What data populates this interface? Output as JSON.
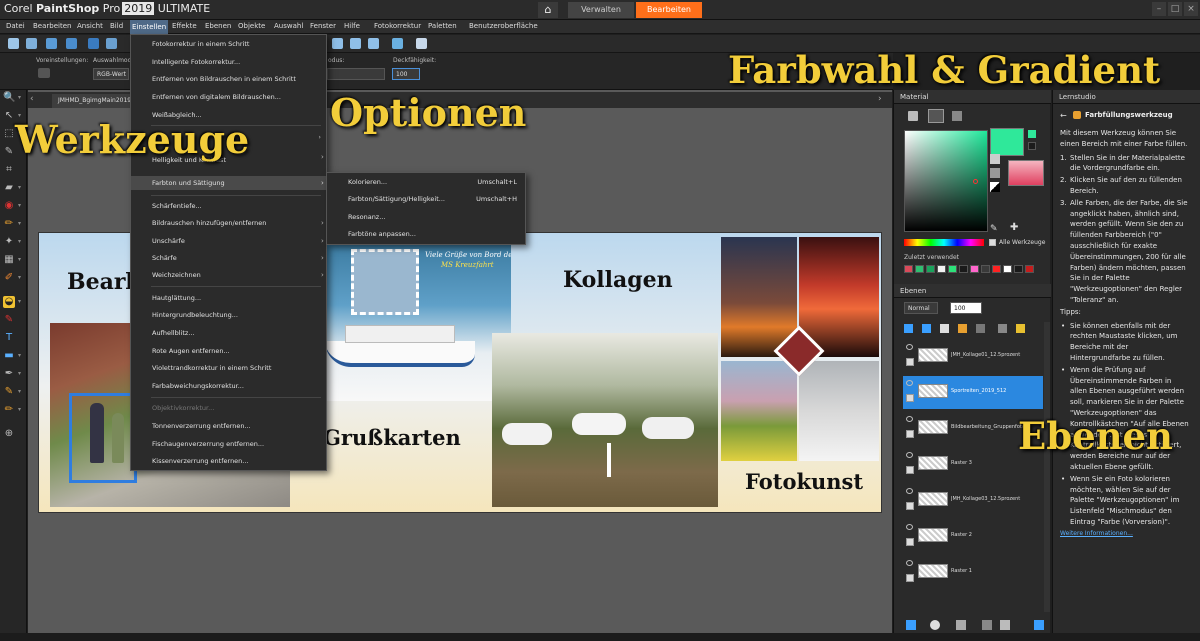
{
  "app": {
    "brand": "Corel",
    "product": "PaintShop",
    "pro": "Pro",
    "year": "2019",
    "edition": "ULTIMATE",
    "workspace_tabs": [
      "Verwalten",
      "Bearbeiten"
    ],
    "active_workspace": "Bearbeiten"
  },
  "menubar": [
    "Datei",
    "Bearbeiten",
    "Ansicht",
    "Bild",
    "Einstellen",
    "Effekte",
    "Ebenen",
    "Objekte",
    "Auswahl",
    "Fenster",
    "Hilfe",
    "Fotokorrektur",
    "Paletten",
    "Benutzeroberfläche"
  ],
  "options": {
    "preset_label": "Voreinstellungen:",
    "select_label": "Auswahlmodus",
    "select_value": "RGB-Wert",
    "mode_label": "odus:",
    "opacity_label": "Deckfähigkeit:",
    "opacity_value": "100"
  },
  "document": {
    "tab": "JMHMD_BgimgMain2019_512.pspimage"
  },
  "menu_einstellen": [
    {
      "label": "Fotokorrektur in einem Schritt"
    },
    {
      "label": "Intelligente Fotokorrektur..."
    },
    {
      "label": "Entfernen von Bildrauschen in einem Schritt"
    },
    {
      "label": "Entfernen von digitalem Bildrauschen..."
    },
    {
      "label": "Weißabgleich..."
    },
    {
      "label": "Helligkeit und Kontrast"
    },
    {
      "label": "Farbton und Sättigung"
    },
    {
      "label": "Schärfentiefe..."
    },
    {
      "label": "Bildrauschen hinzufügen/entfernen"
    },
    {
      "label": "Unschärfe"
    },
    {
      "label": "Schärfe"
    },
    {
      "label": "Weichzeichnen"
    },
    {
      "label": "Hautglättung..."
    },
    {
      "label": "Hintergrundbeleuchtung..."
    },
    {
      "label": "Aufhellblitz..."
    },
    {
      "label": "Rote Augen entfernen..."
    },
    {
      "label": "Violettrandkorrektur in einem Schritt"
    },
    {
      "label": "Farbabweichungskorrektur..."
    },
    {
      "label": "Objektivkorrektur..."
    },
    {
      "label": "Tonnenverzerrung entfernen..."
    },
    {
      "label": "Fischaugenverzerrung entfernen..."
    },
    {
      "label": "Kissenverzerrung entfernen..."
    }
  ],
  "submenu_farbton": [
    {
      "label": "Kolorieren...",
      "shortcut": "Umschalt+L"
    },
    {
      "label": "Farbton/Sättigung/Helligkeit...",
      "shortcut": "Umschalt+H"
    },
    {
      "label": "Resonanz...",
      "shortcut": ""
    },
    {
      "label": "Farbtöne anpassen...",
      "shortcut": ""
    }
  ],
  "canvas": {
    "bearb": "Bearb",
    "kollagen": "Kollagen",
    "grusskarten": "Grußkarten",
    "fotokunst": "Fotokunst",
    "greeting": "Viele Grüße von Bord der",
    "ship": "MS Kreuzfahrt"
  },
  "overlays": {
    "werkzeuge": "Werkzeuge",
    "optionen": "Optionen",
    "farbwahl": "Farbwahl & Gradient",
    "ebenen": "Ebenen"
  },
  "material": {
    "title": "Material",
    "all_tools": "Alle Werkzeuge",
    "recent": "Zuletzt verwendet",
    "recent_colors": [
      "#d94a5a",
      "#2fbf71",
      "#1aa35c",
      "#f2f2f2",
      "#2de27a",
      "#1a1a1a",
      "#ff66cc",
      "#3a3a3a",
      "#ff2222",
      "#ffffff",
      "#1a1a1a",
      "#c51d1d"
    ],
    "fg_color": "#2fe89a",
    "bg_color": "#1c1c1c"
  },
  "layers": {
    "title": "Ebenen",
    "blend": "Normal",
    "opacity": "100",
    "items": [
      {
        "name": "JMH_Kollage01_12.5prozent"
      },
      {
        "name": "Sportreiten_2019_512"
      },
      {
        "name": "Bildbearbeitung_Gruppenfoto"
      },
      {
        "name": "Raster 3"
      },
      {
        "name": "JMH_Kollage03_12.5prozent"
      },
      {
        "name": "Raster 2"
      },
      {
        "name": "Raster 1"
      }
    ],
    "selected_index": 1
  },
  "lernstudio": {
    "title": "Lernstudio",
    "heading": "Farbfüllungswerkzeug",
    "intro": "Mit diesem Werkzeug können Sie einen Bereich mit einer Farbe füllen.",
    "steps": [
      "Stellen Sie in der Materialpalette die Vordergrundfarbe ein.",
      "Klicken Sie auf den zu füllenden Bereich.",
      "Alle Farben, die der Farbe, die Sie angeklickt haben, ähnlich sind, werden gefüllt. Wenn Sie den zu füllenden Farbbereich (\"0\" ausschließlich für exakte Übereinstimmungen, 200 für alle Farben) ändern möchten, passen Sie in der Palette \"Werkzeugoptionen\" den Regler \"Toleranz\" an."
    ],
    "tips_label": "Tipps:",
    "tips": [
      "Sie können ebenfalls mit der rechten Maustaste klicken, um Bereiche mit der Hintergrundfarbe zu füllen.",
      "Wenn die Prüfung auf Übereinstimmende Farben in allen Ebenen ausgeführt werden soll, markieren Sie in der Palette \"Werkzeugoptionen\" das Kontrollkästchen \"Auf alle Ebenen anwenden\". Ist dieses Kontrollkästchen nicht aktiviert, werden Bereiche nur auf der aktuellen Ebene gefüllt.",
      "Wenn Sie ein Foto kolorieren möchten, wählen Sie auf der Palette \"Werkzeugoptionen\" im Listenfeld \"Mischmodus\" den Eintrag \"Farbe (Vorversion)\"."
    ],
    "more_link": "Weitere Informationen..."
  }
}
